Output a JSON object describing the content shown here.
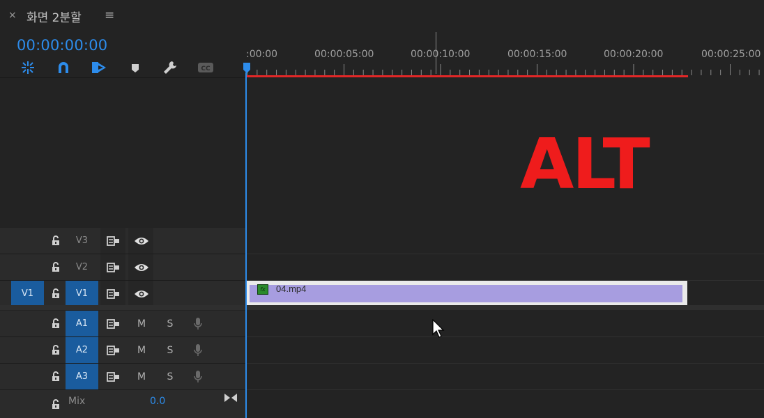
{
  "panel": {
    "close_glyph": "×",
    "title": "화면 2분할",
    "menu_glyph": "≡",
    "timecode": "00:00:00:00"
  },
  "toolbar": {
    "icons": [
      "nest-sequence-icon",
      "snap-magnet-icon",
      "linked-selection-icon",
      "add-marker-icon",
      "timeline-settings-wrench-icon",
      "captions-cc-icon"
    ]
  },
  "ruler": {
    "labels": [
      ":00:00",
      "00:00:05:00",
      "00:00:10:00",
      "00:00:15:00",
      "00:00:20:00",
      "00:00:25:00"
    ]
  },
  "preview": {
    "overlay_text": "ALT",
    "overlay_color": "#ef1c1c"
  },
  "tracks": {
    "video": [
      {
        "name": "V3",
        "targeted": false,
        "source_patch": ""
      },
      {
        "name": "V2",
        "targeted": false,
        "source_patch": ""
      },
      {
        "name": "V1",
        "targeted": true,
        "source_patch": "V1"
      }
    ],
    "audio": [
      {
        "name": "A1",
        "mute": "M",
        "solo": "S"
      },
      {
        "name": "A2",
        "mute": "M",
        "solo": "S"
      },
      {
        "name": "A3",
        "mute": "M",
        "solo": "S"
      }
    ],
    "mix": {
      "label": "Mix",
      "value": "0.0"
    }
  },
  "clip": {
    "name": "04.mp4",
    "fx_badge": "fx",
    "color": "#a79de0"
  },
  "colors": {
    "accent": "#2d8ceb",
    "work_area": "#e22727",
    "target_fill": "#1a5c9e"
  }
}
